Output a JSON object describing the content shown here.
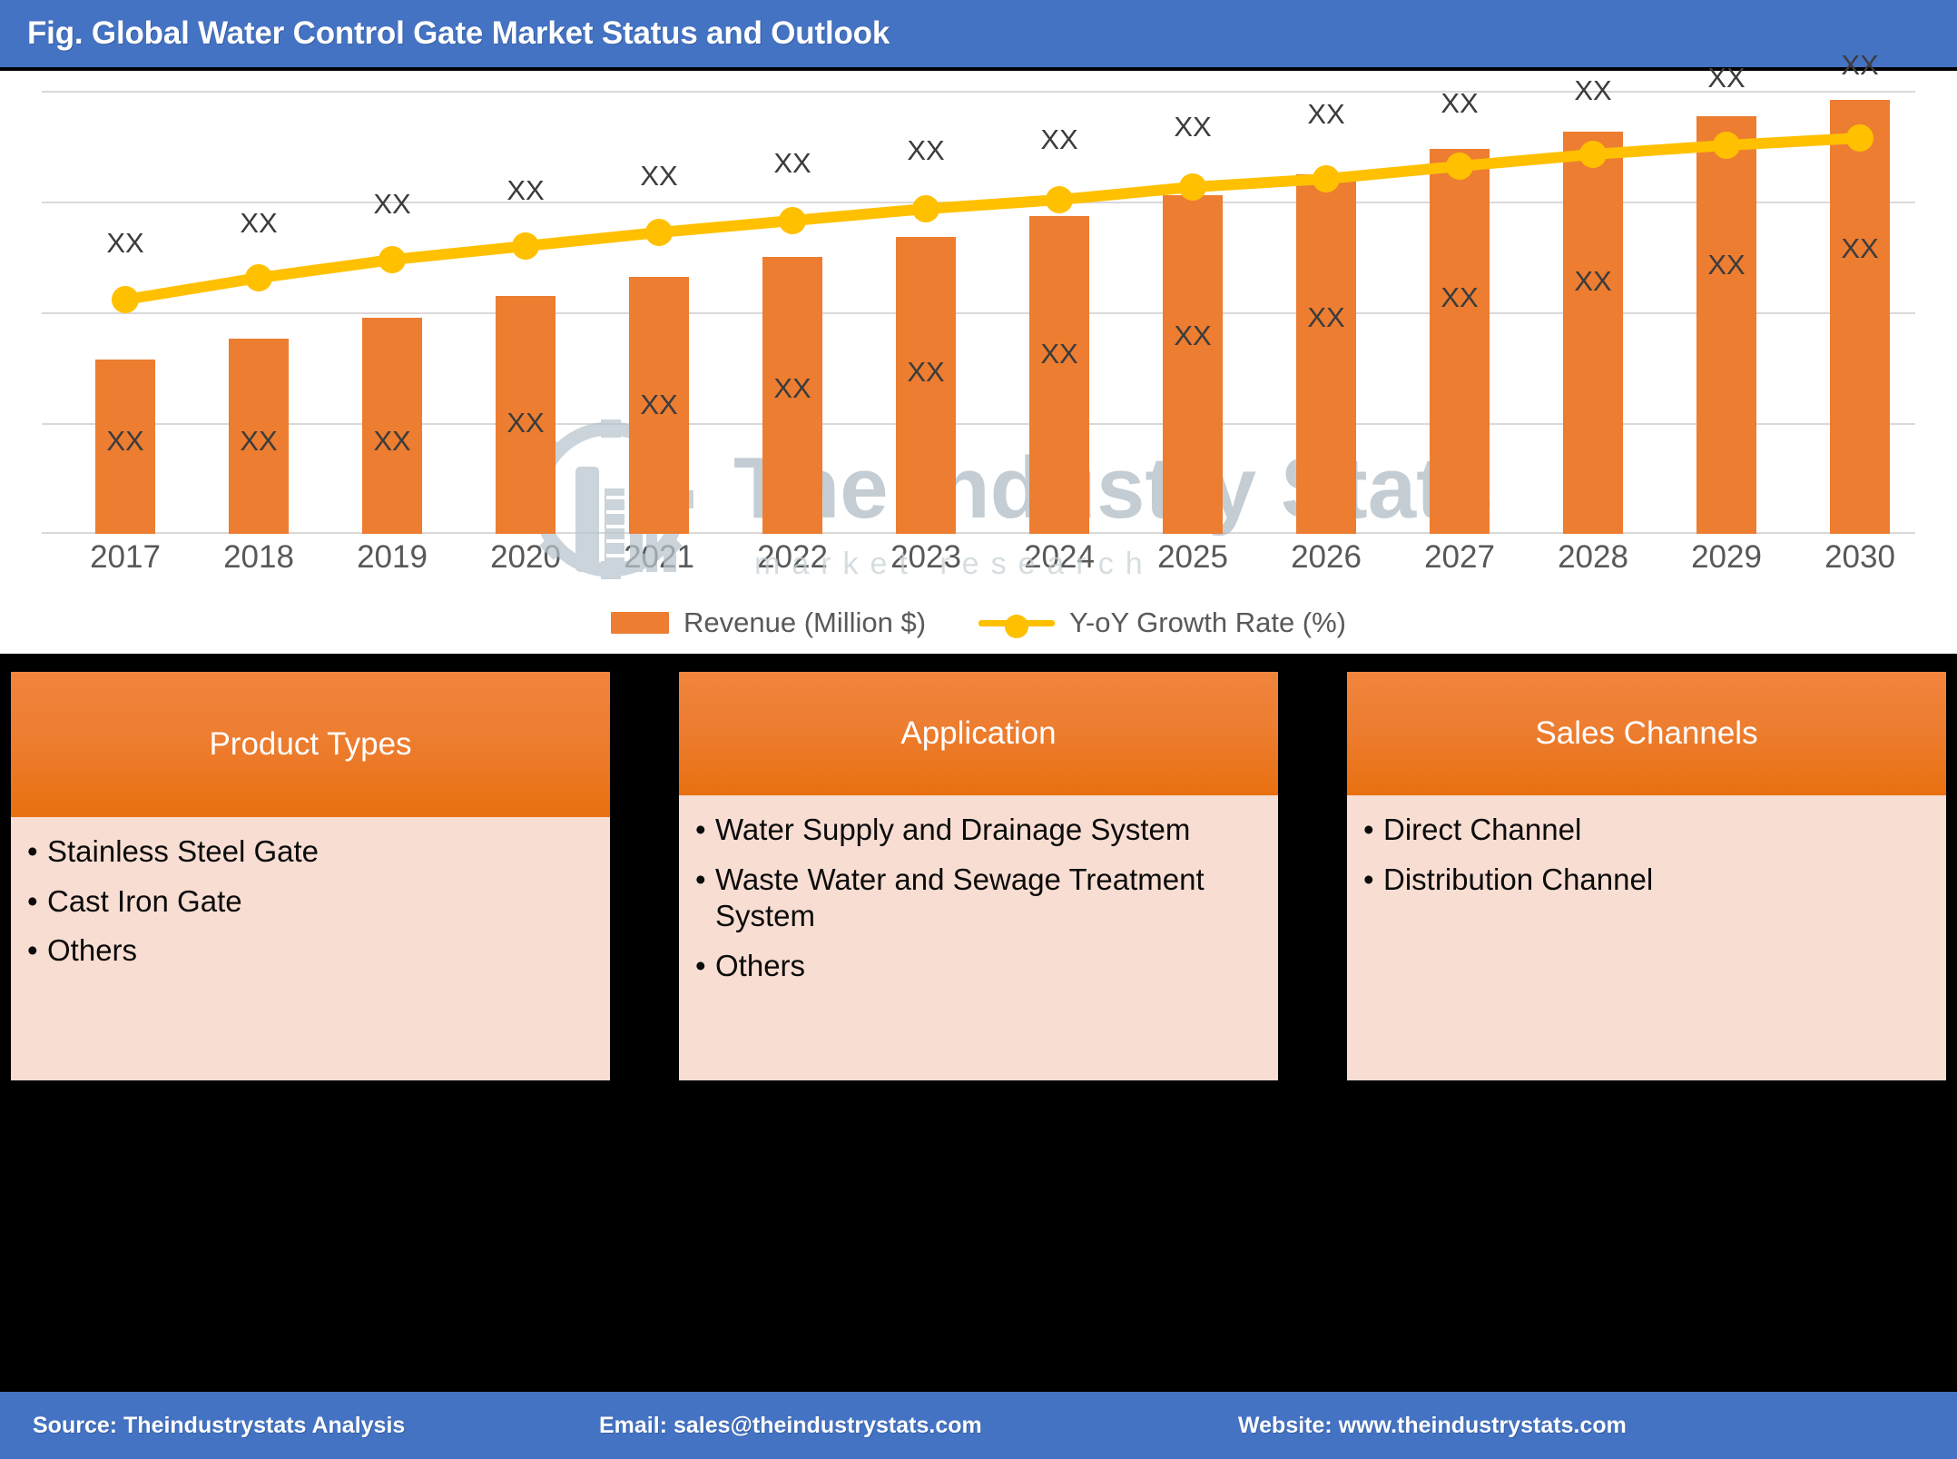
{
  "header": {
    "title": "Fig. Global Water Control Gate Market Status and Outlook"
  },
  "colors": {
    "title_bar": "#4473C4",
    "bar_series": "#ED7D31",
    "line_series": "#FFC000",
    "card_header": "#ED7D31",
    "card_body": "#F8DDD2",
    "gridline": "#D9D9D9",
    "page_background": "#000000"
  },
  "watermark": {
    "brand": "The Industry Stats",
    "tagline": "m a r k e t   r e s e a r c h",
    "logo_icon": "gear-wrench-building-icon"
  },
  "chart_data": {
    "type": "bar",
    "title": "",
    "xlabel": "",
    "ylabel": "",
    "grid": true,
    "legend_position": "bottom",
    "categories": [
      "2017",
      "2018",
      "2019",
      "2020",
      "2021",
      "2022",
      "2023",
      "2024",
      "2025",
      "2026",
      "2027",
      "2028",
      "2029",
      "2030"
    ],
    "ylim": [
      0,
      100
    ],
    "series": [
      {
        "name": "Revenue (Million $)",
        "type": "bar",
        "color": "#ED7D31",
        "values": [
          39,
          44,
          49,
          54,
          58,
          62,
          67,
          72,
          77,
          82,
          88,
          92,
          96,
          100
        ],
        "data_labels": [
          "XX",
          "XX",
          "XX",
          "XX",
          "XX",
          "XX",
          "XX",
          "XX",
          "XX",
          "XX",
          "XX",
          "XX",
          "XX",
          "XX"
        ],
        "top_labels": [
          "XX",
          "XX",
          "XX",
          "XX",
          "XX",
          "XX",
          "XX",
          "XX",
          "XX",
          "XX",
          "XX",
          "XX",
          "XX",
          "XX"
        ]
      },
      {
        "name": "Y-oY Growth Rate (%)",
        "type": "line",
        "color": "#FFC000",
        "marker": "circle",
        "values": [
          57,
          62,
          66,
          69,
          72,
          75,
          78,
          80,
          83,
          85,
          88,
          91,
          93,
          95
        ],
        "data_labels": [
          "XX",
          "XX",
          "XX",
          "XX",
          "XX",
          "XX",
          "XX",
          "XX",
          "XX",
          "XX",
          "XX",
          "XX",
          "XX",
          "XX"
        ]
      }
    ],
    "legend": [
      {
        "label": "Revenue (Million $)",
        "marker": "square",
        "color": "#ED7D31"
      },
      {
        "label": "Y-oY Growth Rate (%)",
        "marker": "line-circle",
        "color": "#FFC000"
      }
    ]
  },
  "cards": [
    {
      "title": "Product Types",
      "items": [
        "Stainless Steel Gate",
        "Cast Iron Gate",
        "Others"
      ]
    },
    {
      "title": "Application",
      "items": [
        "Water Supply and Drainage System",
        "Waste Water and Sewage Treatment System",
        "Others"
      ]
    },
    {
      "title": "Sales Channels",
      "items": [
        "Direct Channel",
        "Distribution Channel"
      ]
    }
  ],
  "footer": {
    "source": "Source: Theindustrystats Analysis",
    "email": "Email: sales@theindustrystats.com",
    "website": "Website: www.theindustrystats.com"
  }
}
